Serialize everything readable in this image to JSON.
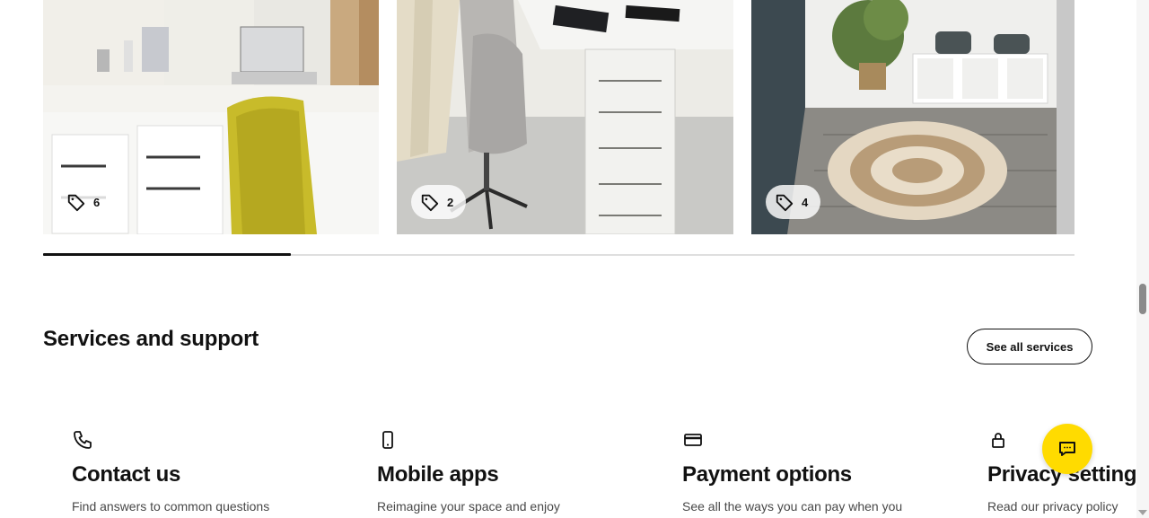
{
  "carousel": {
    "cards": [
      {
        "tag_count": "6",
        "tag_icon": "price-tag-icon"
      },
      {
        "tag_count": "2",
        "tag_icon": "price-tag-icon"
      },
      {
        "tag_count": "4",
        "tag_icon": "price-tag-icon"
      }
    ],
    "scroll_progress": 0.24
  },
  "services": {
    "title": "Services and support",
    "see_all_label": "See all services",
    "items": [
      {
        "icon": "phone-icon",
        "title": "Contact us",
        "description": "Find answers to common questions"
      },
      {
        "icon": "mobile-icon",
        "title": "Mobile apps",
        "description": "Reimagine your space and enjoy"
      },
      {
        "icon": "credit-card-icon",
        "title": "Payment options",
        "description": "See all the ways you can pay when you"
      },
      {
        "icon": "lock-icon",
        "title": "Privacy settings",
        "description": "Read our privacy policy"
      }
    ]
  },
  "chat": {
    "icon": "chat-icon"
  },
  "colors": {
    "accent_yellow": "#ffdb00",
    "text": "#111111",
    "muted_text": "#484848"
  }
}
